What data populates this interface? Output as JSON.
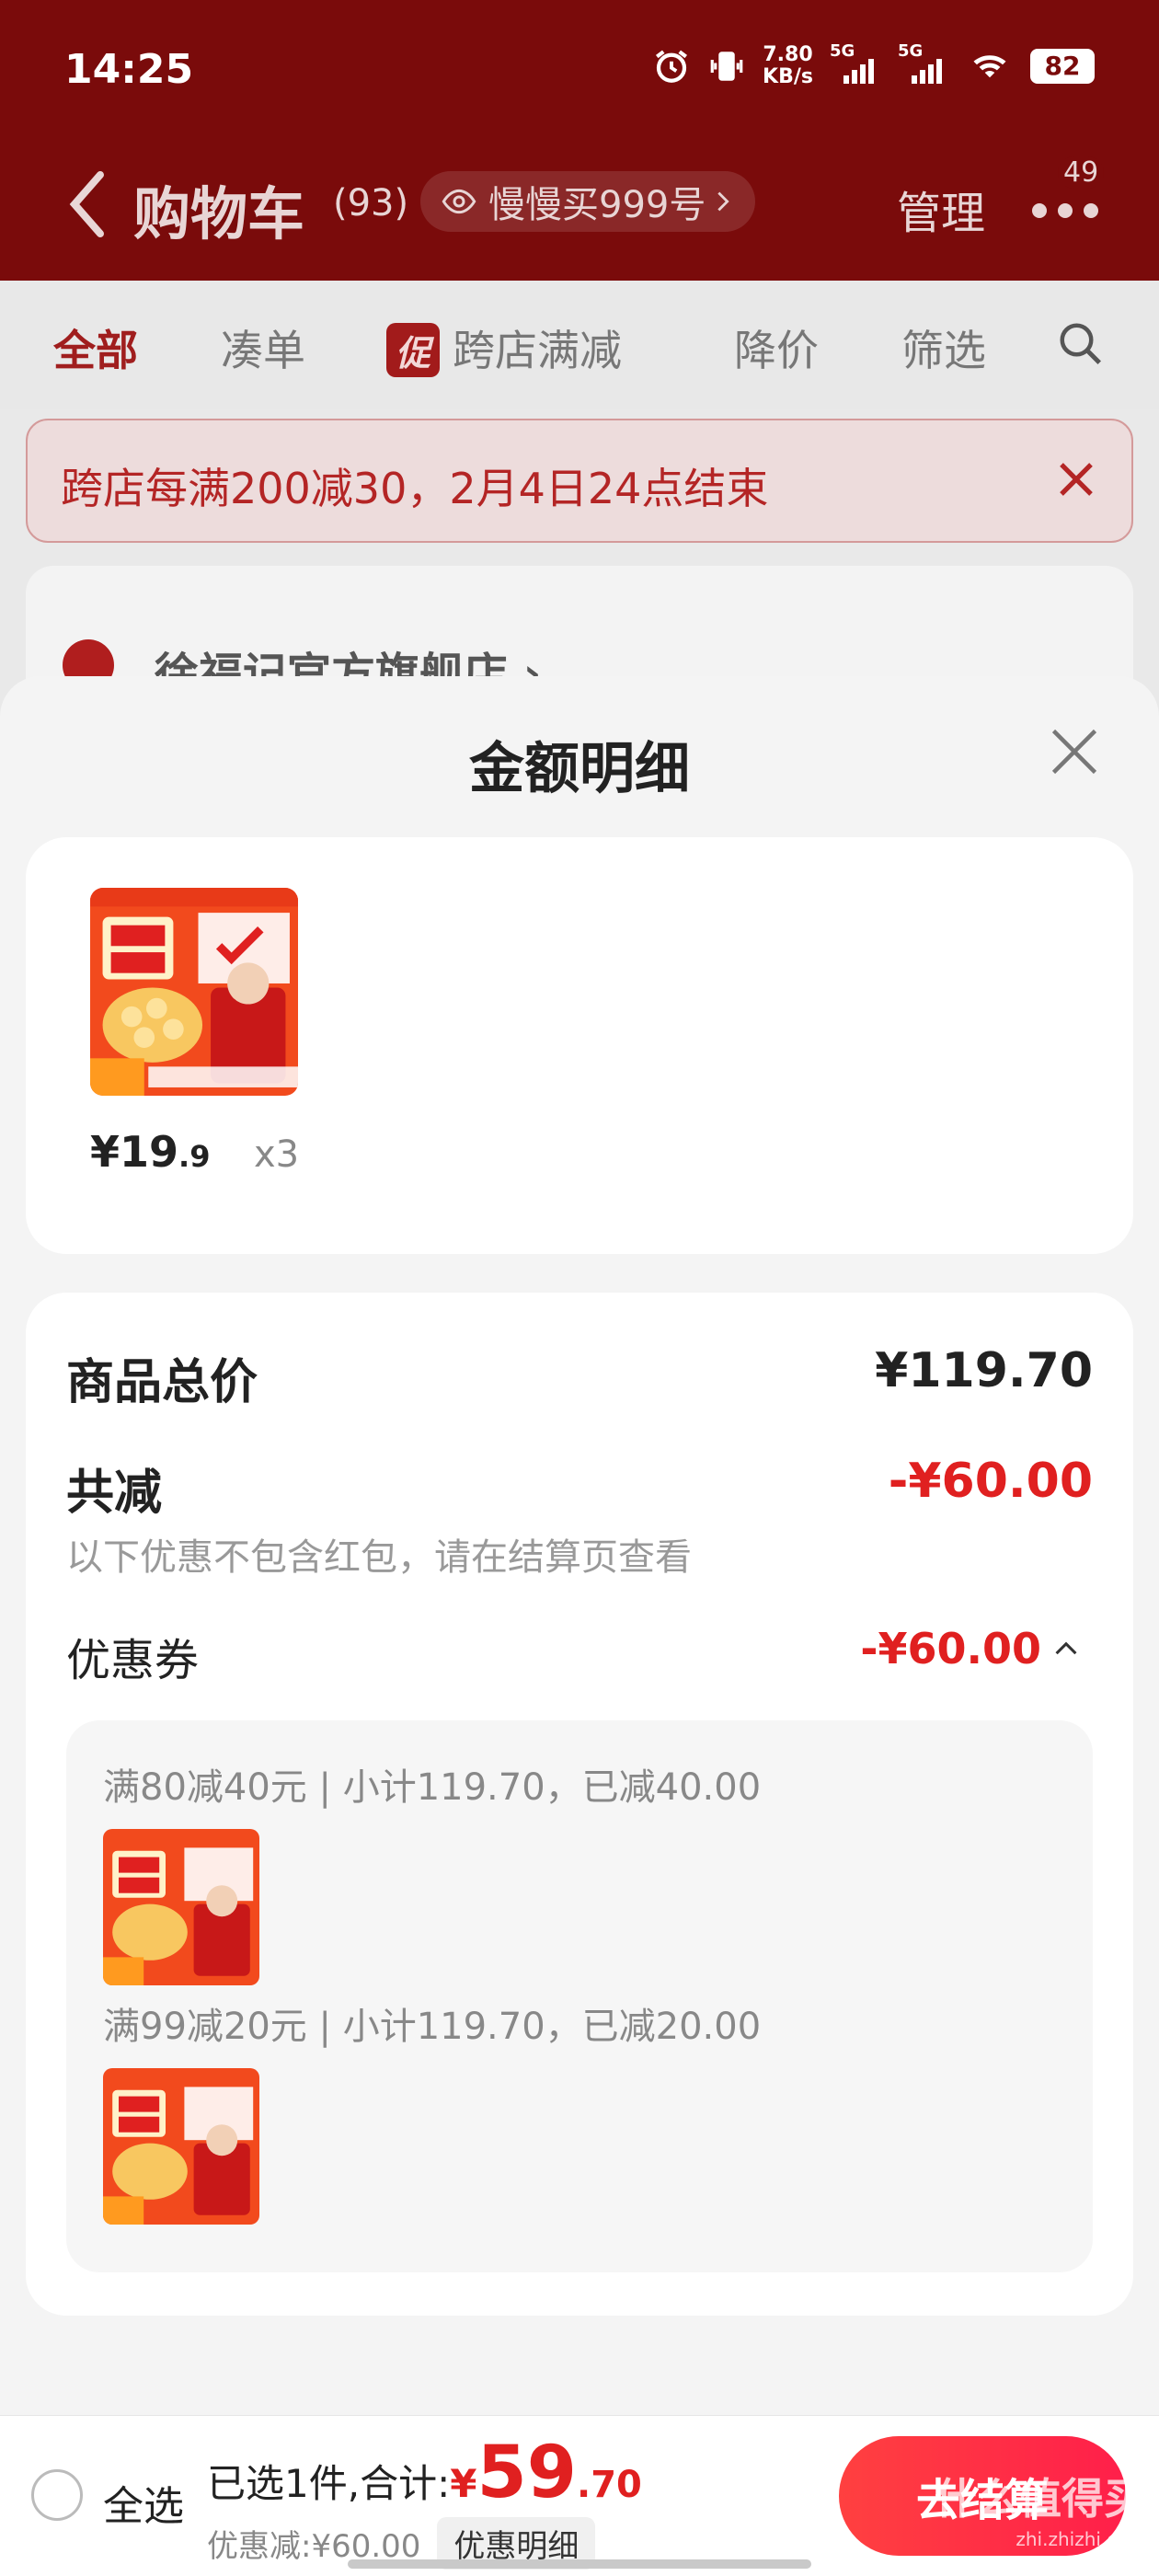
{
  "status_bar": {
    "time": "14:25",
    "net_speed_value": "7.80",
    "net_speed_unit": "KB/s",
    "signal1_label": "5G",
    "signal2_label": "5G",
    "battery": "82"
  },
  "header": {
    "title": "购物车",
    "count": "(93)",
    "slow_buy_label": "慢慢买999号",
    "manage_label": "管理",
    "more_badge": "49"
  },
  "tabs": [
    {
      "label": "全部"
    },
    {
      "label": "凑单"
    },
    {
      "label": "跨店满减",
      "chip": "促"
    },
    {
      "label": "降价"
    },
    {
      "label": "筛选"
    }
  ],
  "promo_banner": {
    "text": "跨店每满200减30，2月4日24点结束"
  },
  "store": {
    "name": "徐福记官方旗舰店 ›"
  },
  "sheet": {
    "title": "金额明细",
    "product": {
      "price_int": "¥19",
      "price_dec": ".9",
      "qty": "x3"
    },
    "summary": {
      "total_label": "商品总价",
      "total_value": "¥119.70",
      "reduce_label": "共减",
      "reduce_value": "-¥60.00",
      "note": "以下优惠不包含红包，请在结算页查看",
      "coupon_label": "优惠券",
      "coupon_value": "-¥60.00",
      "coupon_rules": [
        {
          "text": "满80减40元 | 小计119.70，已减40.00"
        },
        {
          "text": "满99减20元 | 小计119.70，已减20.00"
        }
      ]
    }
  },
  "bottom_bar": {
    "select_all_label": "全选",
    "selected_text": "已选1件,合计:",
    "yen": "¥",
    "total_int": "59",
    "total_dec": ".70",
    "discount_text": "优惠减:¥60.00",
    "detail_label": "优惠明细",
    "checkout_label": "去结算"
  },
  "watermark": {
    "main": "什么值得买",
    "sub": "zhi.zhizhi.com"
  },
  "colors": {
    "accent_red": "#e02020",
    "header_dim": "#7a0b0b",
    "checkout_gradient_start": "#ff4040",
    "checkout_gradient_end": "#ff1f4a"
  },
  "icons": [
    "back-icon",
    "eye-icon",
    "chevron-right-icon",
    "more-icon",
    "search-icon",
    "close-icon",
    "chevron-up-icon",
    "alarm-icon",
    "vibrate-icon",
    "signal-icon",
    "wifi-icon"
  ]
}
